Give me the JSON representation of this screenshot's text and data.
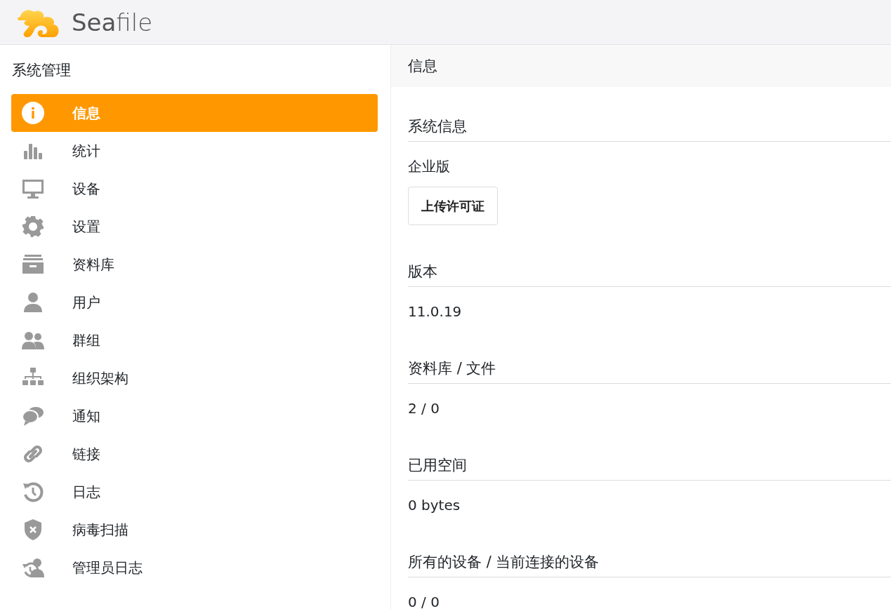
{
  "header": {
    "logo_text": "**Sea**file"
  },
  "sidebar": {
    "title": "系统管理",
    "items": [
      {
        "label": "信息",
        "selected": true
      },
      {
        "label": "统计",
        "selected": false
      },
      {
        "label": "设备",
        "selected": false
      },
      {
        "label": "设置",
        "selected": false
      },
      {
        "label": "资料库",
        "selected": false
      },
      {
        "label": "用户",
        "selected": false
      },
      {
        "label": "群组",
        "selected": false
      },
      {
        "label": "组织架构",
        "selected": false
      },
      {
        "label": "通知",
        "selected": false
      },
      {
        "label": "链接",
        "selected": false
      },
      {
        "label": "日志",
        "selected": false
      },
      {
        "label": "病毒扫描",
        "selected": false
      },
      {
        "label": "管理员日志",
        "selected": false
      }
    ]
  },
  "main": {
    "title": "信息",
    "sections": [
      {
        "title": "系统信息",
        "value": "企业版",
        "button": "上传许可证"
      },
      {
        "title": "版本",
        "value": "11.0.19"
      },
      {
        "title": "资料库 / 文件",
        "value": "2 / 0"
      },
      {
        "title": "已用空间",
        "value": "0 bytes"
      },
      {
        "title": "所有的设备 / 当前连接的设备",
        "value": "0 / 0"
      }
    ]
  }
}
